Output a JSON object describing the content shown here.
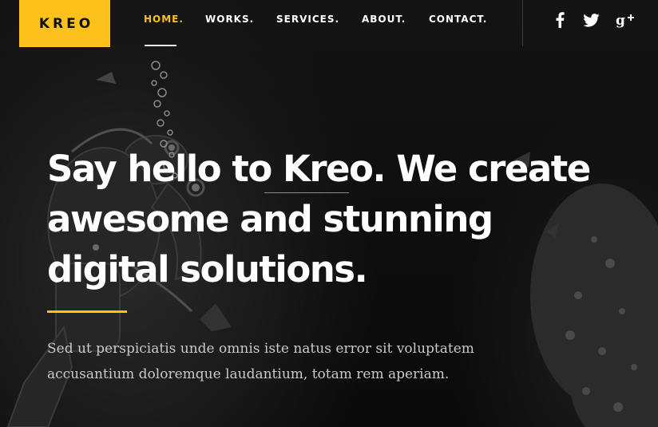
{
  "brand": {
    "logo_text": "KREO",
    "accent_color": "#fcc21b"
  },
  "nav": {
    "items": [
      {
        "label": "HOME.",
        "active": true
      },
      {
        "label": "WORKS.",
        "active": false
      },
      {
        "label": "SERVICES.",
        "active": false
      },
      {
        "label": "ABOUT.",
        "active": false
      },
      {
        "label": "CONTACT.",
        "active": false
      }
    ]
  },
  "social": [
    {
      "icon": "facebook-icon"
    },
    {
      "icon": "twitter-icon"
    },
    {
      "icon": "google-plus-icon"
    }
  ],
  "hero": {
    "title": "Say hello to Kreo. We create awesome and stunning digital solutions.",
    "subtitle": "Sed ut perspiciatis unde omnis iste natus error sit voluptatem accusantium doloremque laudantium, totam rem aperiam."
  }
}
